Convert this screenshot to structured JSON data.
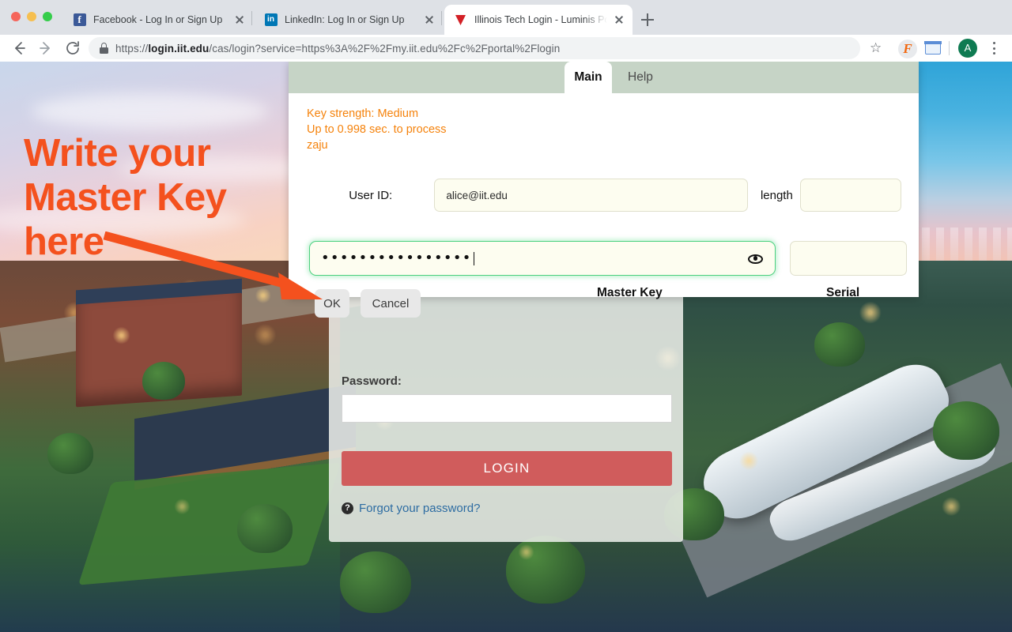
{
  "browser": {
    "window_controls": [
      "close",
      "minimize",
      "maximize"
    ],
    "tabs": [
      {
        "title": "Facebook - Log In or Sign Up",
        "favicon": "facebook-icon",
        "active": false
      },
      {
        "title": "LinkedIn: Log In or Sign Up",
        "favicon": "linkedin-icon",
        "active": false
      },
      {
        "title": "Illinois Tech Login - Luminis Po",
        "favicon": "illinois-tech-icon",
        "active": true
      }
    ],
    "new_tab_label": "+",
    "toolbar": {
      "back": "←",
      "forward": "→",
      "reload": "⟳",
      "url_scheme": "https://",
      "url_host": "login.iit.edu",
      "url_path": "/cas/login?service=https%3A%2F%2Fmy.iit.edu%2Fc%2Fportal%2Flogin",
      "lock_icon": "lock-icon",
      "bookmark_icon": "☆",
      "extension_badge": "F",
      "profile_initial": "A",
      "menu_icon": "kebab-menu-icon"
    }
  },
  "annotation": {
    "text": "Write your\nMaster Key\nhere",
    "color": "#f4511e",
    "arrow": "arrow-pointing-to-master-key-field"
  },
  "dialog": {
    "tabs": [
      {
        "label": "Main",
        "selected": true
      },
      {
        "label": "Help",
        "selected": false
      }
    ],
    "strength": {
      "line1": "Key strength: Medium",
      "line2": "Up to 0.998 sec. to process",
      "line3": "zaju",
      "color": "#f5820b"
    },
    "fields": {
      "userid_label": "User ID:",
      "userid_value": "alice@iit.edu",
      "length_label": "length",
      "length_value": "",
      "masterkey_header": "Master Key",
      "masterkey_value": "••••••••••••••••",
      "serial_header": "Serial",
      "serial_value": "",
      "reveal_icon": "eye-icon"
    },
    "buttons": {
      "ok": "OK",
      "cancel": "Cancel"
    },
    "accent_green": "#4bd07f",
    "header_green": "#c6d4c6"
  },
  "login_form": {
    "password_label": "Password:",
    "password_value": "",
    "login_button": "LOGIN",
    "forgot_text": "Forgot your password?",
    "help_icon": "question-mark-icon",
    "button_color": "#d05c5c",
    "link_color": "#2d6ca2"
  }
}
